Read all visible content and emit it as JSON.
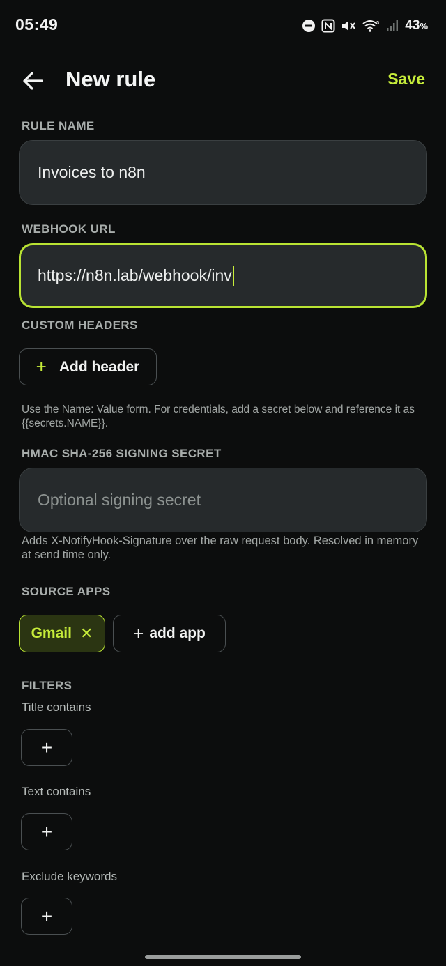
{
  "status_bar": {
    "time": "05:49",
    "battery": "43",
    "battery_unit": "%",
    "icons": [
      "dnd-icon",
      "nfc-icon",
      "mute-icon",
      "wifi-icon",
      "signal-icon"
    ]
  },
  "app_bar": {
    "back_icon": "arrow-left-icon",
    "title": "New rule",
    "save_label": "Save"
  },
  "rule_name": {
    "label": "RULE NAME",
    "value": "Invoices to n8n"
  },
  "webhook": {
    "label": "WEBHOOK URL",
    "value": "https://n8n.lab/webhook/inv"
  },
  "headers": {
    "label": "CUSTOM HEADERS",
    "button_label": "Add header",
    "helper": "Use the Name: Value form. For credentials, add a secret below and reference it as {{secrets.NAME}}."
  },
  "hmac": {
    "label": "HMAC SHA-256 SIGNING SECRET",
    "placeholder": "Optional signing secret",
    "helper": "Adds X-NotifyHook-Signature over the raw request body. Resolved in memory at send time only."
  },
  "source_apps": {
    "label": "SOURCE APPS",
    "chips": [
      {
        "label": "Gmail"
      }
    ],
    "add_label": "add app"
  },
  "filters": {
    "label": "FILTERS",
    "items": [
      {
        "label": "Title contains"
      },
      {
        "label": "Text contains"
      },
      {
        "label": "Exclude keywords"
      }
    ]
  },
  "colors": {
    "accent": "#c6ec3a",
    "background": "#0c0d0d",
    "field": "#262a2c"
  }
}
